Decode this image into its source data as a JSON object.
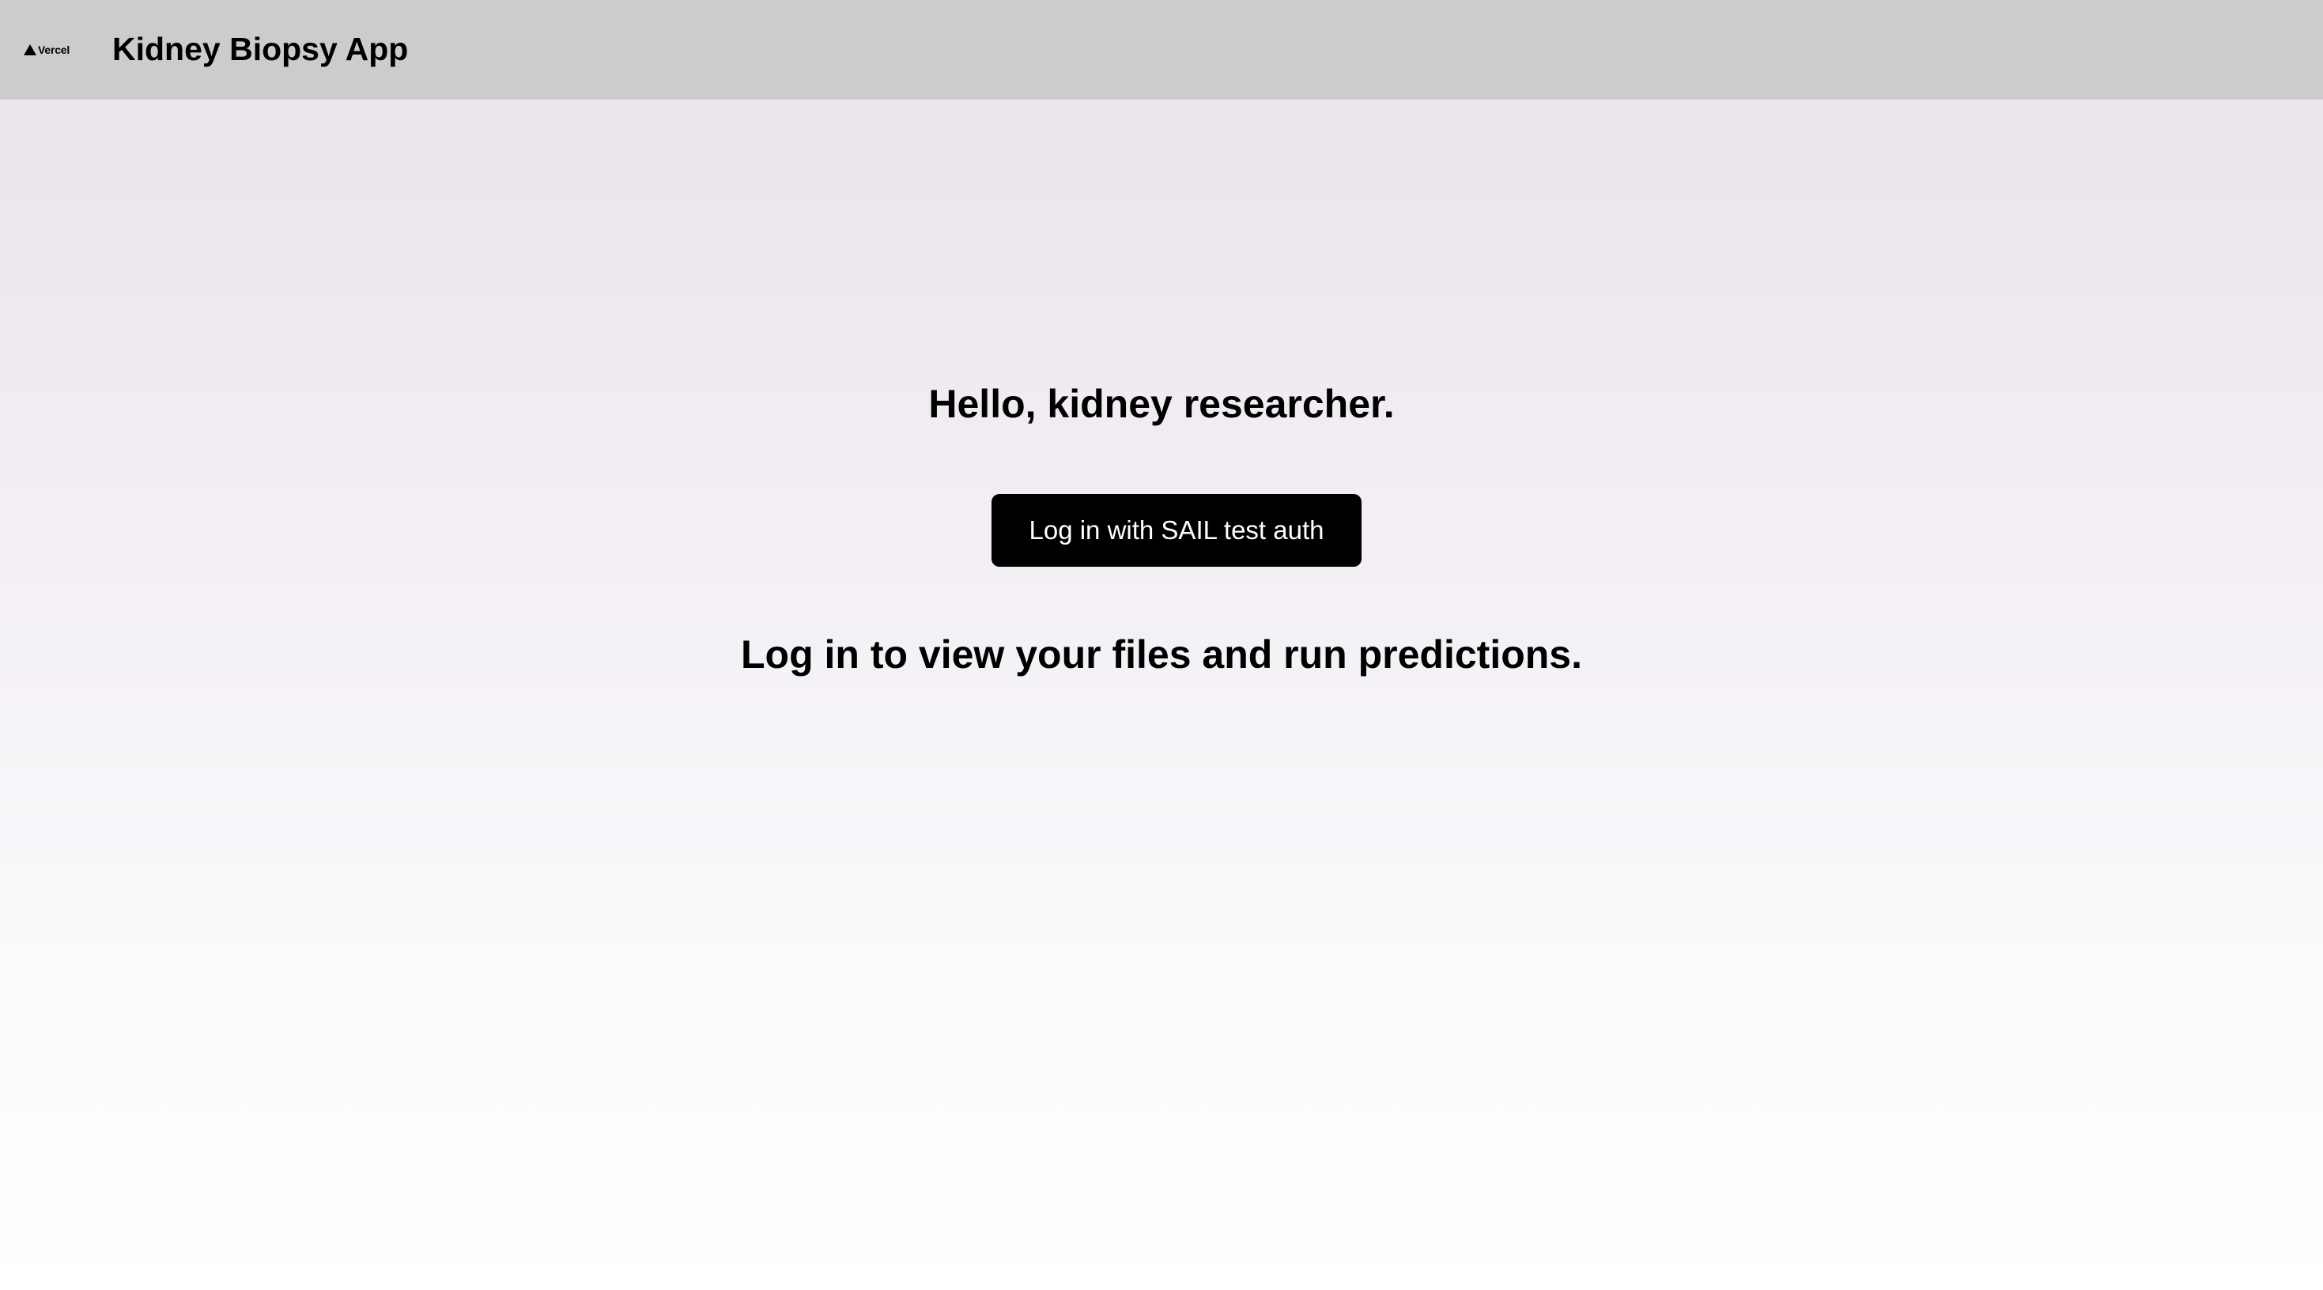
{
  "header": {
    "logo_text": "Vercel",
    "title": "Kidney Biopsy App"
  },
  "main": {
    "greeting": "Hello, kidney researcher.",
    "login_button_label": "Log in with SAIL test auth",
    "login_hint": "Log in to view your files and run predictions."
  },
  "colors": {
    "header_background": "#cccccc",
    "button_background": "#000000",
    "button_text": "#ffffff",
    "text": "#000000"
  }
}
